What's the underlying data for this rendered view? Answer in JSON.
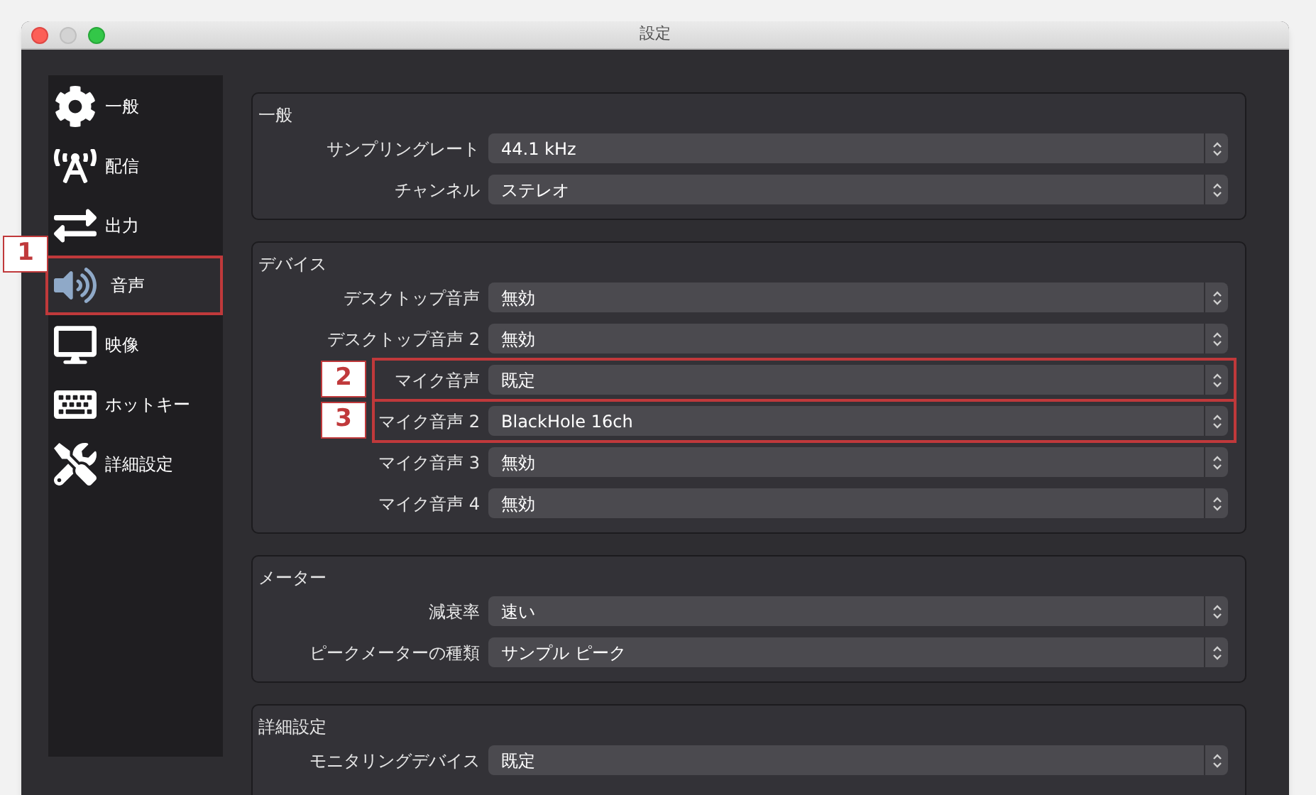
{
  "window": {
    "title": "設定"
  },
  "sidebar": {
    "items": [
      {
        "label": "一般",
        "selected": false
      },
      {
        "label": "配信",
        "selected": false
      },
      {
        "label": "出力",
        "selected": false
      },
      {
        "label": "音声",
        "selected": true,
        "callout": "1"
      },
      {
        "label": "映像",
        "selected": false
      },
      {
        "label": "ホットキー",
        "selected": false
      },
      {
        "label": "詳細設定",
        "selected": false
      }
    ]
  },
  "groups": [
    {
      "title": "一般",
      "rows": [
        {
          "label": "サンプリングレート",
          "value": "44.1 kHz"
        },
        {
          "label": "チャンネル",
          "value": "ステレオ"
        }
      ]
    },
    {
      "title": "デバイス",
      "rows": [
        {
          "label": "デスクトップ音声",
          "value": "無効"
        },
        {
          "label": "デスクトップ音声 2",
          "value": "無効"
        },
        {
          "label": "マイク音声",
          "value": "既定",
          "callout": "2"
        },
        {
          "label": "マイク音声 2",
          "value": "BlackHole 16ch",
          "callout": "3"
        },
        {
          "label": "マイク音声 3",
          "value": "無効"
        },
        {
          "label": "マイク音声 4",
          "value": "無効"
        }
      ]
    },
    {
      "title": "メーター",
      "rows": [
        {
          "label": "減衰率",
          "value": "速い"
        },
        {
          "label": "ピークメーターの種類",
          "value": "サンプル ピーク"
        }
      ]
    },
    {
      "title": "詳細設定",
      "rows": [
        {
          "label": "モニタリングデバイス",
          "value": "既定"
        }
      ]
    }
  ]
}
